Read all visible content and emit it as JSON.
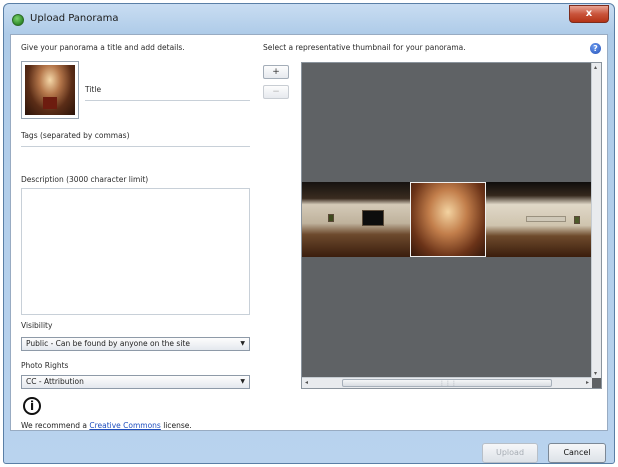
{
  "window": {
    "title": "Upload Panorama",
    "close_label": "x"
  },
  "left": {
    "intro": "Give your panorama a title and add details.",
    "title_label": "Title",
    "tags_label": "Tags (separated by commas)",
    "description_label": "Description (3000 character limit)",
    "visibility_label": "Visibility",
    "visibility_value": "Public - Can be found by anyone on the site",
    "rights_label": "Photo Rights",
    "rights_value": "CC - Attribution",
    "cc_glyph": "i",
    "recommend_prefix": "We recommend a ",
    "recommend_link": "Creative Commons",
    "recommend_suffix": " license."
  },
  "right": {
    "intro": "Select a representative thumbnail for your panorama.",
    "help_glyph": "?",
    "zoom_in": "+",
    "zoom_out": "−",
    "scroll_left": "◂",
    "scroll_right": "▸",
    "scroll_up": "▴",
    "scroll_down": "▾",
    "scroll_grip": "⋮⋮⋮"
  },
  "footer": {
    "upload_label": "Upload",
    "cancel_label": "Cancel"
  },
  "icons": {
    "app": "panorama-app-icon",
    "help": "help-icon",
    "cc": "creative-commons-attribution-icon",
    "dropdown": "chevron-down-icon"
  },
  "colors": {
    "title_bar": "#b9d3ee",
    "close": "#c9543b",
    "viewer_bg": "#5f6265",
    "link": "#1f4fbf"
  }
}
